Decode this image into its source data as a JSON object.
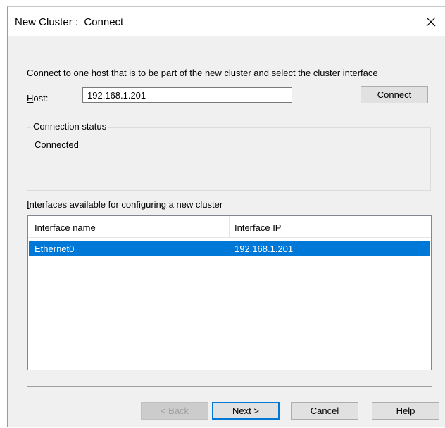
{
  "window": {
    "title": "New Cluster :  Connect",
    "close_icon": "close-icon"
  },
  "instructions": "Connect to one host that is to be part of the new cluster and select the cluster interface",
  "host": {
    "label_prefix": "H",
    "label_rest": "ost:",
    "value": "192.168.1.201"
  },
  "connect_button": {
    "prefix": "C",
    "underline": "o",
    "rest": "nnect"
  },
  "connection_status": {
    "title": "Connection status",
    "value": "Connected"
  },
  "interfaces": {
    "label_underline": "I",
    "label_rest": "nterfaces available for configuring a new cluster",
    "columns": [
      "Interface name",
      "Interface IP"
    ],
    "rows": [
      {
        "name": "Ethernet0",
        "ip": "192.168.1.201",
        "selected": true
      }
    ]
  },
  "buttons": {
    "back": {
      "prefix": "< ",
      "underline": "B",
      "rest": "ack",
      "enabled": false
    },
    "next": {
      "underline": "N",
      "rest": "ext >"
    },
    "cancel": "Cancel",
    "help": "Help"
  },
  "colors": {
    "selection": "#0078d7",
    "dialog_bg": "#f0f0f0"
  }
}
